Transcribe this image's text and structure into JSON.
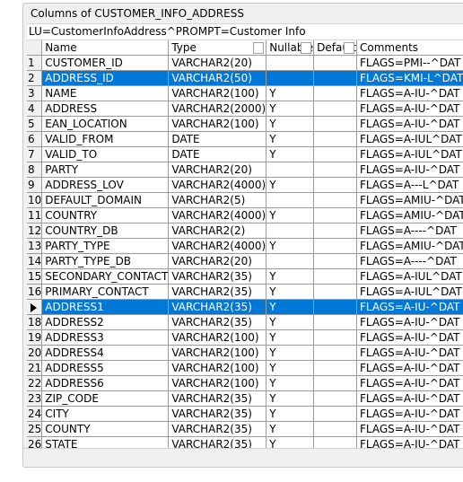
{
  "window": {
    "title": "Columns of CUSTOMER_INFO_ADDRESS"
  },
  "table_comment": "LU=CustomerInfoAddress^PROMPT=Customer Info",
  "columns": {
    "name": "Name",
    "type": "Type",
    "nullable": "Nullable",
    "default": "Default",
    "comments": "Comments"
  },
  "rows": [
    {
      "num": "1",
      "name": "CUSTOMER_ID",
      "type": "VARCHAR2(20)",
      "nullable": "",
      "default": "",
      "comments": "FLAGS=PMI--^DAT"
    },
    {
      "num": "2",
      "name": "ADDRESS_ID",
      "type": "VARCHAR2(50)",
      "nullable": "",
      "default": "",
      "comments": "FLAGS=KMI-L^DAT"
    },
    {
      "num": "3",
      "name": "NAME",
      "type": "VARCHAR2(100)",
      "nullable": "Y",
      "default": "",
      "comments": "FLAGS=A-IU-^DAT"
    },
    {
      "num": "4",
      "name": "ADDRESS",
      "type": "VARCHAR2(2000)",
      "nullable": "Y",
      "default": "",
      "comments": "FLAGS=A-IU-^DAT"
    },
    {
      "num": "5",
      "name": "EAN_LOCATION",
      "type": "VARCHAR2(100)",
      "nullable": "Y",
      "default": "",
      "comments": "FLAGS=A-IU-^DAT"
    },
    {
      "num": "6",
      "name": "VALID_FROM",
      "type": "DATE",
      "nullable": "Y",
      "default": "",
      "comments": "FLAGS=A-IUL^DAT"
    },
    {
      "num": "7",
      "name": "VALID_TO",
      "type": "DATE",
      "nullable": "Y",
      "default": "",
      "comments": "FLAGS=A-IUL^DAT"
    },
    {
      "num": "8",
      "name": "PARTY",
      "type": "VARCHAR2(20)",
      "nullable": "",
      "default": "",
      "comments": "FLAGS=A-IU-^DAT"
    },
    {
      "num": "9",
      "name": "ADDRESS_LOV",
      "type": "VARCHAR2(4000)",
      "nullable": "Y",
      "default": "",
      "comments": "FLAGS=A---L^DAT"
    },
    {
      "num": "10",
      "name": "DEFAULT_DOMAIN",
      "type": "VARCHAR2(5)",
      "nullable": "",
      "default": "",
      "comments": "FLAGS=AMIU-^DAT"
    },
    {
      "num": "11",
      "name": "COUNTRY",
      "type": "VARCHAR2(4000)",
      "nullable": "Y",
      "default": "",
      "comments": "FLAGS=AMIU-^DAT"
    },
    {
      "num": "12",
      "name": "COUNTRY_DB",
      "type": "VARCHAR2(2)",
      "nullable": "",
      "default": "",
      "comments": "FLAGS=A----^DAT"
    },
    {
      "num": "13",
      "name": "PARTY_TYPE",
      "type": "VARCHAR2(4000)",
      "nullable": "Y",
      "default": "",
      "comments": "FLAGS=AMIU-^DAT"
    },
    {
      "num": "14",
      "name": "PARTY_TYPE_DB",
      "type": "VARCHAR2(20)",
      "nullable": "",
      "default": "",
      "comments": "FLAGS=A----^DAT"
    },
    {
      "num": "15",
      "name": "SECONDARY_CONTACT",
      "type": "VARCHAR2(35)",
      "nullable": "Y",
      "default": "",
      "comments": "FLAGS=A-IUL^DAT"
    },
    {
      "num": "16",
      "name": "PRIMARY_CONTACT",
      "type": "VARCHAR2(35)",
      "nullable": "Y",
      "default": "",
      "comments": "FLAGS=A-IUL^DAT"
    },
    {
      "num": "",
      "name": "ADDRESS1",
      "type": "VARCHAR2(35)",
      "nullable": "Y",
      "default": "",
      "comments": "FLAGS=A-IU-^DAT"
    },
    {
      "num": "18",
      "name": "ADDRESS2",
      "type": "VARCHAR2(35)",
      "nullable": "Y",
      "default": "",
      "comments": "FLAGS=A-IU-^DAT"
    },
    {
      "num": "19",
      "name": "ADDRESS3",
      "type": "VARCHAR2(100)",
      "nullable": "Y",
      "default": "",
      "comments": "FLAGS=A-IU-^DAT"
    },
    {
      "num": "20",
      "name": "ADDRESS4",
      "type": "VARCHAR2(100)",
      "nullable": "Y",
      "default": "",
      "comments": "FLAGS=A-IU-^DAT"
    },
    {
      "num": "21",
      "name": "ADDRESS5",
      "type": "VARCHAR2(100)",
      "nullable": "Y",
      "default": "",
      "comments": "FLAGS=A-IU-^DAT"
    },
    {
      "num": "22",
      "name": "ADDRESS6",
      "type": "VARCHAR2(100)",
      "nullable": "Y",
      "default": "",
      "comments": "FLAGS=A-IU-^DAT"
    },
    {
      "num": "23",
      "name": "ZIP_CODE",
      "type": "VARCHAR2(35)",
      "nullable": "Y",
      "default": "",
      "comments": "FLAGS=A-IU-^DAT"
    },
    {
      "num": "24",
      "name": "CITY",
      "type": "VARCHAR2(35)",
      "nullable": "Y",
      "default": "",
      "comments": "FLAGS=A-IU-^DAT"
    },
    {
      "num": "25",
      "name": "COUNTY",
      "type": "VARCHAR2(35)",
      "nullable": "Y",
      "default": "",
      "comments": "FLAGS=A-IU-^DAT"
    },
    {
      "num": "26",
      "name": "STATE",
      "type": "VARCHAR2(35)",
      "nullable": "Y",
      "default": "",
      "comments": "FLAGS=A-IU-^DAT"
    }
  ],
  "selected_rows": [
    "2",
    "17"
  ],
  "current_row_icon": "row-pointer-icon",
  "colors": {
    "selection": "#0078d7",
    "header_bg": "#f0f0f0"
  }
}
